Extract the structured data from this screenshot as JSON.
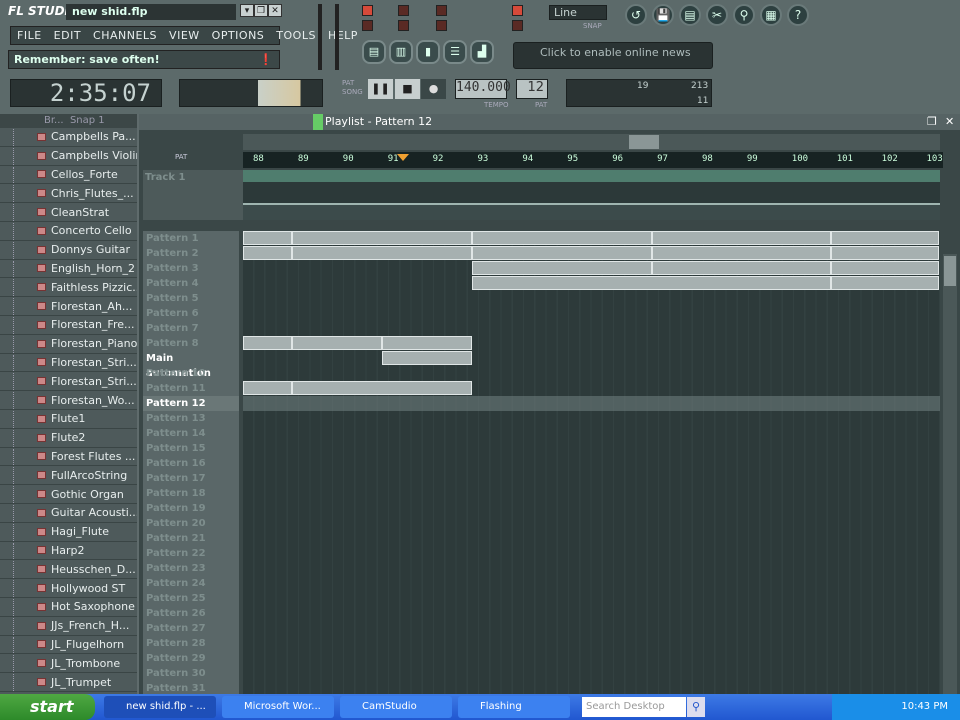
{
  "app": {
    "logo": "FL STUDIO",
    "file": "new shid.flp",
    "hint": "Remember: save often!",
    "time": "2:35:07",
    "tempo": "140.000",
    "tempo_label": "TEMPO",
    "pattern_num": "12",
    "pat_label": "PAT",
    "snap": "Line",
    "snap_label": "SNAP",
    "news": "Click to enable online news",
    "cpu": "19",
    "ram": "213",
    "poly": "11",
    "pat_song": [
      "PAT",
      "SONG"
    ]
  },
  "menu": [
    "FILE",
    "EDIT",
    "CHANNELS",
    "VIEW",
    "OPTIONS",
    "TOOLS",
    "HELP"
  ],
  "browser": {
    "header": "Br...",
    "snap": "Snap 1",
    "channels": [
      "Campbells Pa...",
      "Campbells Violin",
      "Cellos_Forte",
      "Chris_Flutes_...",
      "CleanStrat",
      "Concerto Cello",
      "Donnys Guitar",
      "English_Horn_2",
      "Faithless Pizzic...",
      "Florestan_Ah...",
      "Florestan_Fre...",
      "Florestan_Piano",
      "Florestan_Stri...",
      "Florestan_Stri...",
      "Florestan_Wo...",
      "Flute1",
      "Flute2",
      "Forest Flutes ...",
      "FullArcoString",
      "Gothic Organ",
      "Guitar Acousti...",
      "Hagi_Flute",
      "Harp2",
      "Heusschen_D...",
      "Hollywood ST",
      "Hot Saxophone",
      "JJs_French_H...",
      "JL_Flugelhorn",
      "JL_Trombone",
      "JL_Trumpet"
    ]
  },
  "playlist": {
    "title": "Playlist - Pattern 12",
    "track": "Track 1",
    "modes": "PAT",
    "bars": [
      "88",
      "89",
      "90",
      "91",
      "92",
      "93",
      "94",
      "95",
      "96",
      "97",
      "98",
      "99",
      "100",
      "101",
      "102",
      "103"
    ],
    "rows": [
      "Pattern 1",
      "Pattern 2",
      "Pattern 3",
      "Pattern 4",
      "Pattern 5",
      "Pattern 6",
      "Pattern 7",
      "Pattern 8",
      "Main automation",
      "Pattern 10",
      "Pattern 11",
      "Pattern 12",
      "Pattern 13",
      "Pattern 14",
      "Pattern 15",
      "Pattern 16",
      "Pattern 17",
      "Pattern 18",
      "Pattern 19",
      "Pattern 20",
      "Pattern 21",
      "Pattern 22",
      "Pattern 23",
      "Pattern 24",
      "Pattern 25",
      "Pattern 26",
      "Pattern 27",
      "Pattern 28",
      "Pattern 29",
      "Pattern 30",
      "Pattern 31"
    ],
    "selected_row": "Pattern 12",
    "clips": [
      [
        0,
        88,
        89.1
      ],
      [
        0,
        89.1,
        93.1
      ],
      [
        0,
        93.1,
        97.1
      ],
      [
        0,
        97.1,
        101.1
      ],
      [
        0,
        101.1,
        103.5
      ],
      [
        1,
        88,
        89.1
      ],
      [
        1,
        89.1,
        93.1
      ],
      [
        1,
        93.1,
        97.1
      ],
      [
        1,
        97.1,
        101.1
      ],
      [
        1,
        101.1,
        103.5
      ],
      [
        2,
        93.1,
        97.1
      ],
      [
        2,
        97.1,
        101.1
      ],
      [
        2,
        101.1,
        103.5
      ],
      [
        3,
        93.1,
        101.1
      ],
      [
        3,
        101.1,
        103.5
      ],
      [
        7,
        88,
        89.1
      ],
      [
        7,
        89.1,
        91.1
      ],
      [
        7,
        91.1,
        93.1
      ],
      [
        8,
        91.1,
        93.1
      ],
      [
        10,
        88,
        89.1
      ],
      [
        10,
        89.1,
        93.1
      ]
    ]
  },
  "taskbar": {
    "start": "start",
    "tasks": [
      "new shid.flp - ...",
      "Microsoft Wor...",
      "CamStudio",
      "Flashing"
    ],
    "search": "Search Desktop",
    "clock": "10:43 PM"
  }
}
